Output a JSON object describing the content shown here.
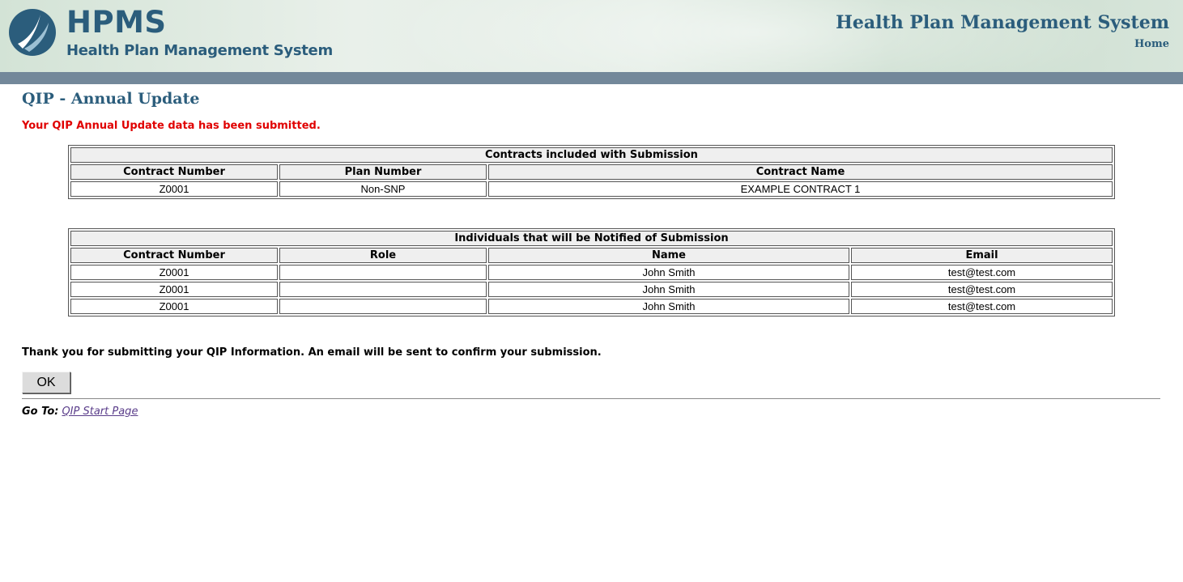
{
  "header": {
    "logo_text": "HPMS",
    "logo_subtitle": "Health Plan Management System",
    "system_title": "Health Plan Management System",
    "home_link": "Home"
  },
  "page": {
    "title": "QIP - Annual Update",
    "alert": "Your QIP Annual Update data has been submitted."
  },
  "contracts_table": {
    "caption": "Contracts included with Submission",
    "headers": [
      "Contract Number",
      "Plan Number",
      "Contract Name"
    ],
    "rows": [
      [
        "Z0001",
        "Non-SNP",
        "EXAMPLE CONTRACT 1"
      ]
    ]
  },
  "notify_table": {
    "caption": "Individuals that will be Notified of Submission",
    "headers": [
      "Contract Number",
      "Role",
      "Name",
      "Email"
    ],
    "rows": [
      [
        "Z0001",
        "",
        "John Smith",
        "test@test.com"
      ],
      [
        "Z0001",
        "",
        "John Smith",
        "test@test.com"
      ],
      [
        "Z0001",
        "",
        "John Smith",
        "test@test.com"
      ]
    ]
  },
  "footer": {
    "thanks": "Thank you for submitting your QIP Information. An email will be sent to confirm your submission.",
    "ok_label": "OK",
    "goto_label": "Go To:",
    "goto_link": "QIP Start Page"
  },
  "colors": {
    "brand": "#2b5d7c",
    "alert": "#e00000",
    "bar": "#73889a"
  }
}
